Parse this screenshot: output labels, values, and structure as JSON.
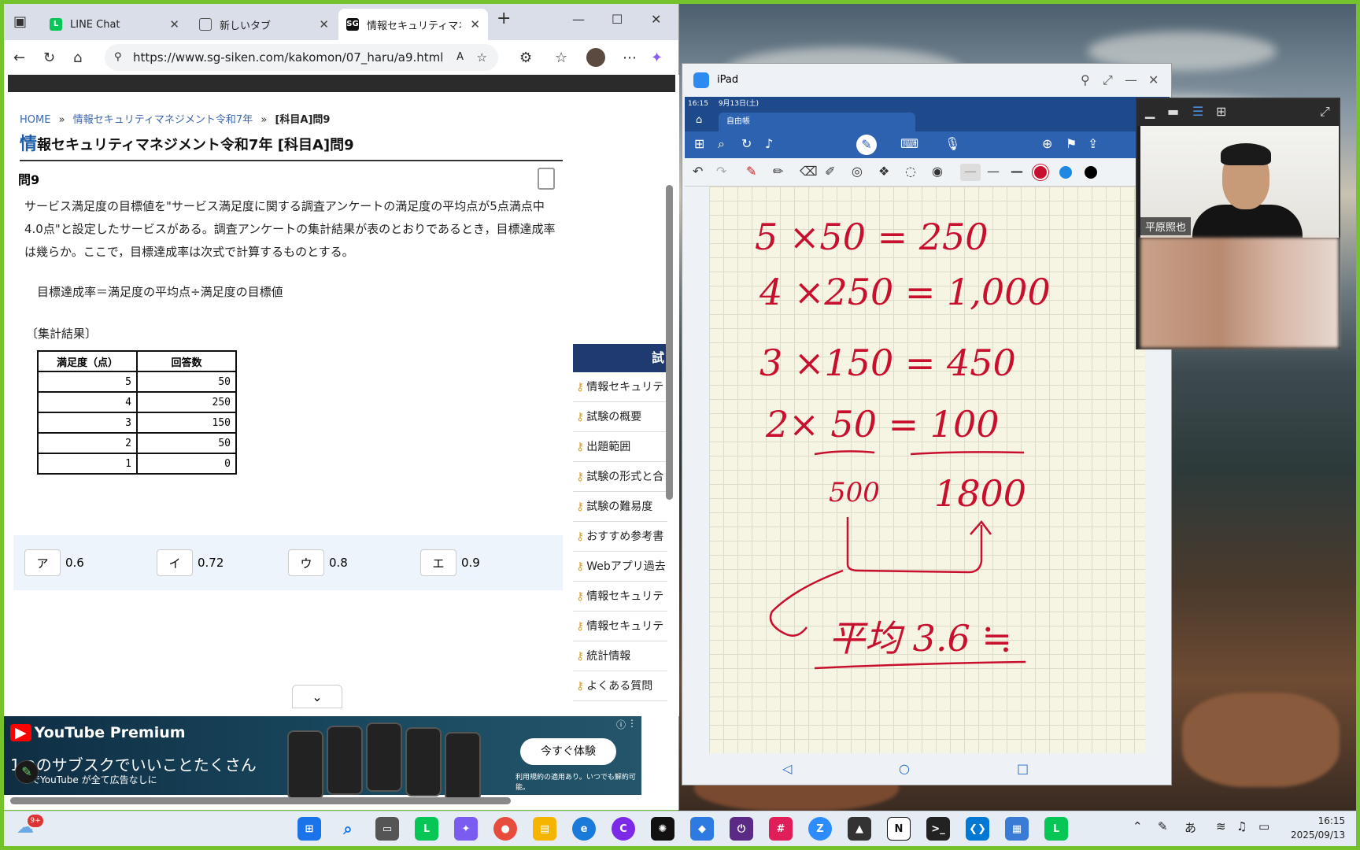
{
  "browser": {
    "tabs": [
      {
        "label": "LINE Chat"
      },
      {
        "label": "新しいタブ"
      },
      {
        "label": "情報セキュリティマネジ"
      }
    ],
    "url": "https://www.sg-siken.com/kakomon/07_haru/a9.html"
  },
  "page": {
    "breadcrumb": {
      "home": "HOME",
      "sep": "»",
      "parent": "情報セキュリティマネジメント令和7年",
      "current": "[科目A]問9"
    },
    "title_first": "情",
    "title_rest": "報セキュリティマネジメント令和7年 [科目A]問9",
    "question_number": "問9",
    "question_text": "サービス満足度の目標値を\"サービス満足度に関する調査アンケートの満足度の平均点が5点満点中4.0点\"と設定したサービスがある。調査アンケートの集計結果が表のとおりであるとき，目標達成率は幾らか。ここで，目標達成率は次式で計算するものとする。",
    "formula": "目標達成率＝満足度の平均点÷満足度の目標値",
    "summary_label": "〔集計結果〕",
    "table": {
      "headers": [
        "満足度（点）",
        "回答数"
      ],
      "rows": [
        [
          "5",
          "50"
        ],
        [
          "4",
          "250"
        ],
        [
          "3",
          "150"
        ],
        [
          "2",
          "50"
        ],
        [
          "1",
          "0"
        ]
      ]
    },
    "answers": [
      {
        "key": "ア",
        "value": "0.6"
      },
      {
        "key": "イ",
        "value": "0.72"
      },
      {
        "key": "ウ",
        "value": "0.8"
      },
      {
        "key": "エ",
        "value": "0.9"
      }
    ],
    "sidebar": {
      "header": "試",
      "items": [
        "情報セキュリテ",
        "試験の概要",
        "出題範囲",
        "試験の形式と合",
        "試験の難易度",
        "おすすめ参考書",
        "Webアプリ過去",
        "情報セキュリテ",
        "情報セキュリテ",
        "統計情報",
        "よくある質問"
      ]
    }
  },
  "ad": {
    "brand": "YouTube Premium",
    "line1": "1つのサブスクでいいことたくさん",
    "line2": "でYouTube が全て広告なしに",
    "cta": "今すぐ体験",
    "note": "利用規約の適用あり。いつでも解約可能。"
  },
  "ipad": {
    "window_title": "iPad",
    "status_time": "16:15",
    "status_date": "9月13日(土)",
    "note_tab": "自由帳",
    "handwriting": [
      "5 ×50 = 250",
      "4 ×250 = 1,000",
      "3 ×150 = 450",
      "2× 50 = 100",
      "500",
      "1800",
      "平均 3.6 ≒"
    ]
  },
  "video": {
    "participant_name": "平原照也"
  },
  "taskbar": {
    "badge": "9+",
    "ime": "あ",
    "time": "16:15",
    "date": "2025/09/13"
  }
}
